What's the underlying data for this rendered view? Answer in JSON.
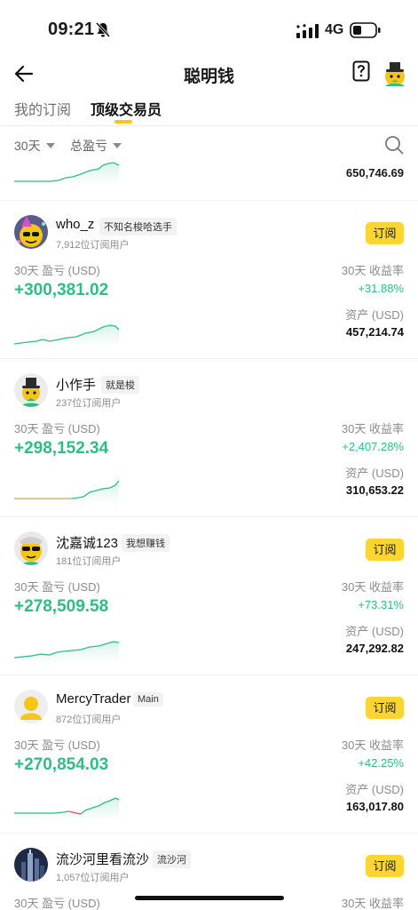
{
  "status": {
    "time": "09:21",
    "network": "4G"
  },
  "nav": {
    "title": "聪明钱"
  },
  "tabs": [
    {
      "label": "我的订阅"
    },
    {
      "label": "顶级交易员"
    }
  ],
  "filters": {
    "period": "30天",
    "sort": "总盈亏"
  },
  "partial_top": {
    "assets": "650,746.69"
  },
  "labels": {
    "pnl": "30天 盈亏 (USD)",
    "roi": "30天 收益率",
    "assets": "资产 (USD)",
    "subscribe": "订阅"
  },
  "colors": {
    "accent": "#fcd535",
    "positive": "#2ebd85",
    "negative": "#f6465d"
  },
  "traders": [
    {
      "name": "who_z",
      "tag": "不知名梭哈选手",
      "subs": "7,912位订阅用户",
      "pnl": "+300,381.02",
      "roi": "+31.88%",
      "assets": "457,214.74",
      "subscribe": true,
      "avatar": "party-face"
    },
    {
      "name": "小作手",
      "tag": "就是梭",
      "subs": "237位订阅用户",
      "pnl": "+298,152.34",
      "roi": "+2,407.28%",
      "assets": "310,653.22",
      "subscribe": false,
      "avatar": "top-hat"
    },
    {
      "name": "沈嘉诚123",
      "tag": "我想赚钱",
      "subs": "181位订阅用户",
      "pnl": "+278,509.58",
      "roi": "+73.31%",
      "assets": "247,292.82",
      "subscribe": true,
      "avatar": "sunglasses"
    },
    {
      "name": "MercyTrader",
      "tag": "Main",
      "subs": "872位订阅用户",
      "pnl": "+270,854.03",
      "roi": "+42.25%",
      "assets": "163,017.80",
      "subscribe": true,
      "avatar": "default-user"
    },
    {
      "name": "流沙河里看流沙",
      "tag": "流沙河",
      "subs": "1,057位订阅用户",
      "pnl": "",
      "roi": "",
      "assets": "",
      "subscribe": true,
      "avatar": "city-night"
    }
  ]
}
